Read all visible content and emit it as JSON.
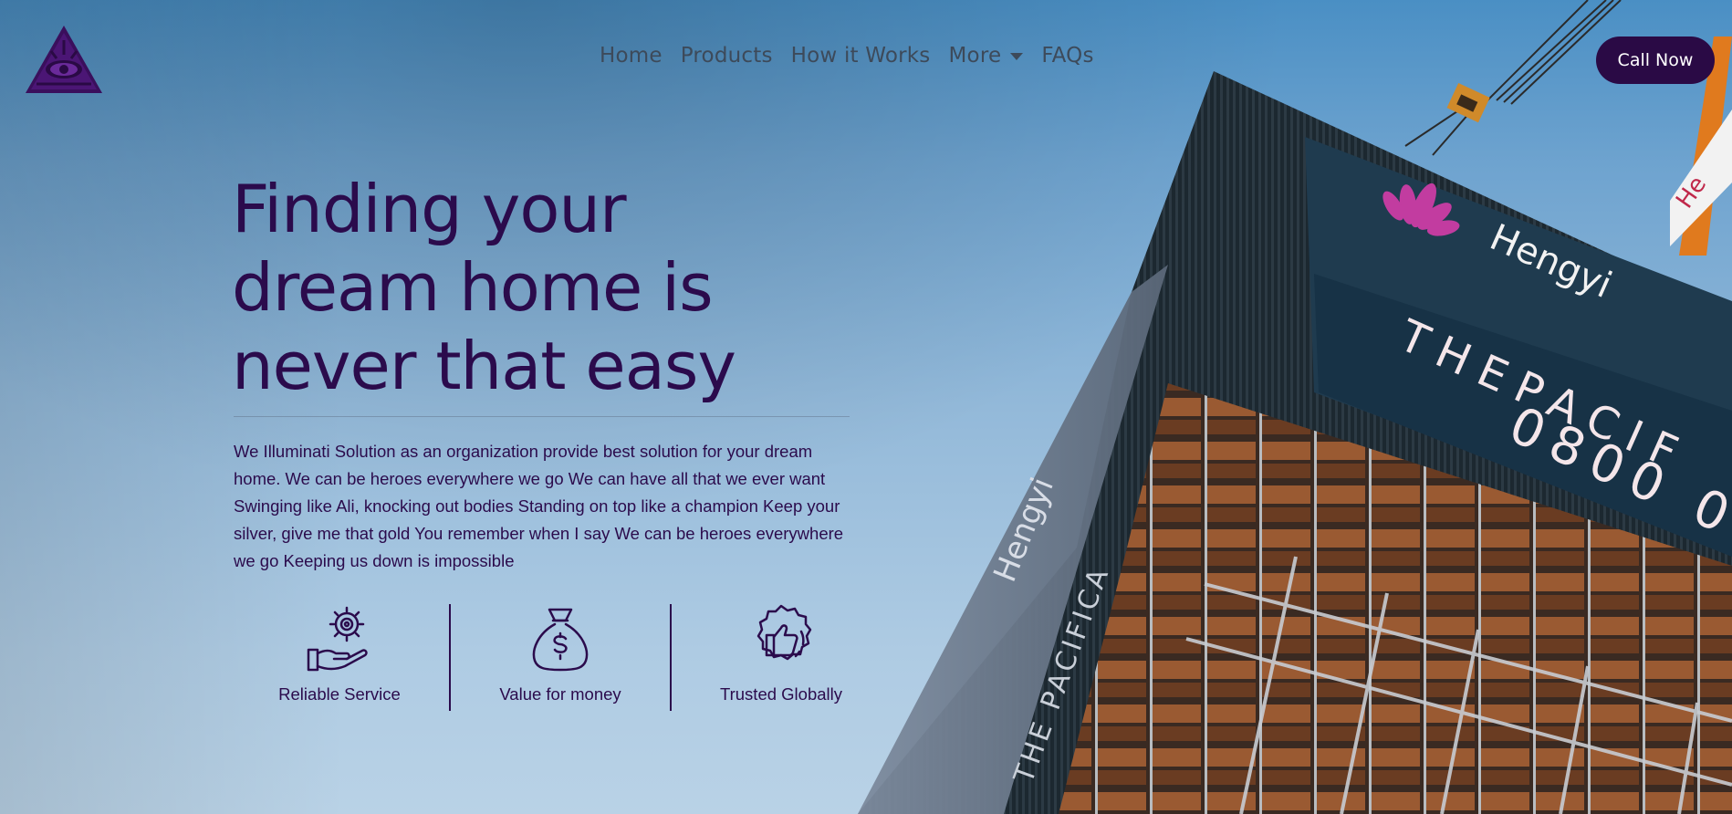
{
  "header": {
    "logo_icon": "illuminati-eye-triangle-icon",
    "nav": [
      {
        "label": "Home"
      },
      {
        "label": "Products"
      },
      {
        "label": "How it Works"
      },
      {
        "label": "More",
        "has_dropdown": true
      },
      {
        "label": "FAQs"
      }
    ],
    "cta_label": "Call Now"
  },
  "hero": {
    "title": "Finding your dream home is never that easy",
    "description": "We Illuminati Solution as an organization provide best solution for your dream home. We can be heroes everywhere we go We can have all that we ever want Swinging like Ali, knocking out bodies Standing on top like a champion Keep your silver, give me that gold You remember when I say We can be heroes everywhere we go Keeping us down is impossible"
  },
  "features": [
    {
      "icon": "gear-hand-icon",
      "label": "Reliable Service"
    },
    {
      "icon": "money-bag-icon",
      "label": "Value for money"
    },
    {
      "icon": "thumbs-up-badge-icon",
      "label": "Trusted Globally"
    }
  ],
  "background": {
    "signage": {
      "brand": "Hengyi",
      "line1": "THEPACIF",
      "line2": "0800 0",
      "side_brand": "Hengyi",
      "side_text": "THE PACIFICA"
    }
  },
  "colors": {
    "brand": "#2a0a45",
    "text": "#2b0b4c",
    "nav": "#3d4a5a",
    "sky_top": "#4a8fc4",
    "sky_bottom": "#b9d2e6"
  }
}
